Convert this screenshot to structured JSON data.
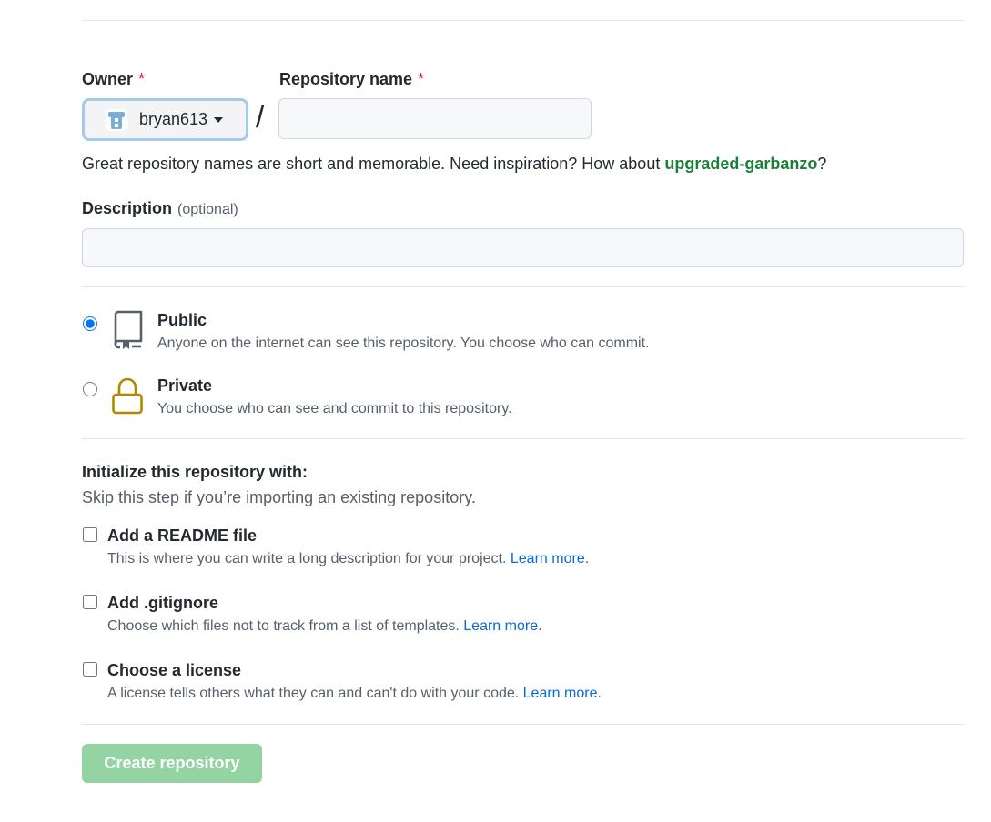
{
  "owner": {
    "label": "Owner",
    "required_mark": "*",
    "selected": "bryan613"
  },
  "repo_name": {
    "label": "Repository name",
    "required_mark": "*",
    "value": "",
    "separator": "/"
  },
  "name_hint": {
    "text": "Great repository names are short and memorable. Need inspiration? How about ",
    "suggestion": "upgraded-garbanzo",
    "suffix": "?"
  },
  "description": {
    "label": "Description",
    "optional": "(optional)",
    "value": ""
  },
  "visibility": {
    "selected": "public",
    "options": [
      {
        "id": "public",
        "title": "Public",
        "description": "Anyone on the internet can see this repository. You choose who can commit.",
        "icon": "repo-icon"
      },
      {
        "id": "private",
        "title": "Private",
        "description": "You choose who can see and commit to this repository.",
        "icon": "lock-icon"
      }
    ]
  },
  "initialize": {
    "title": "Initialize this repository with:",
    "subtitle": "Skip this step if you’re importing an existing repository.",
    "options": [
      {
        "title": "Add a README file",
        "description": "This is where you can write a long description for your project. ",
        "link": "Learn more",
        "end": ".",
        "checked": false
      },
      {
        "title": "Add .gitignore",
        "description": "Choose which files not to track from a list of templates. ",
        "link": "Learn more",
        "end": ".",
        "checked": false
      },
      {
        "title": "Choose a license",
        "description": "A license tells others what they can and can't do with your code. ",
        "link": "Learn more",
        "end": ".",
        "checked": false
      }
    ]
  },
  "submit": {
    "label": "Create repository",
    "disabled": true
  },
  "colors": {
    "accent_green": "#1a7f37",
    "link_blue": "#0969da",
    "required_red": "#cf222e",
    "lock_gold": "#b08800",
    "disabled_button": "#94d3a2"
  }
}
